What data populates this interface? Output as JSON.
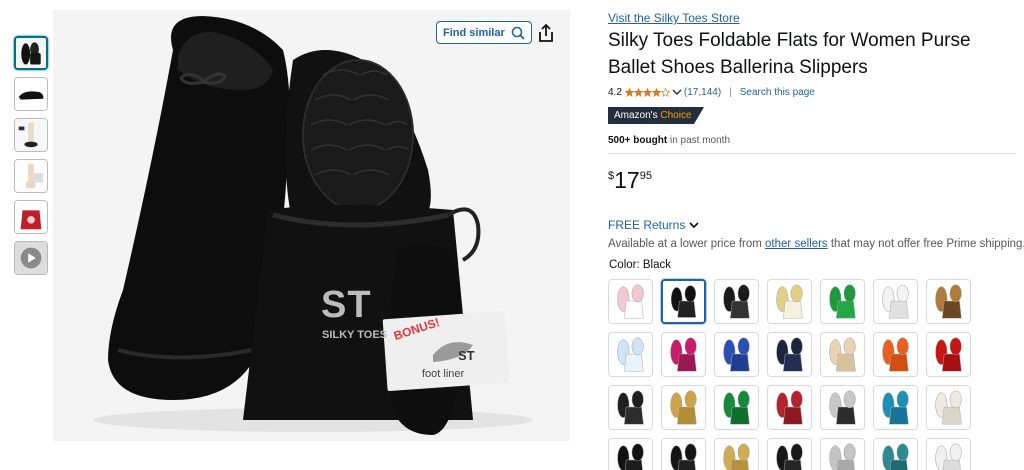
{
  "thumbnails": [
    {
      "name": "thumb-shoes-pouch",
      "active": true
    },
    {
      "name": "thumb-flat-side"
    },
    {
      "name": "thumb-model"
    },
    {
      "name": "thumb-foot-liner"
    },
    {
      "name": "thumb-red-pouch"
    },
    {
      "name": "thumb-video"
    }
  ],
  "main_image": {
    "find_similar_label": "Find similar",
    "logo_text": "ST",
    "logo_caption": "SILKY TOES",
    "bonus_text": "BONUS!",
    "liner_logo": "ST",
    "liner_text": "foot liner"
  },
  "product": {
    "store_link": "Visit the Silky Toes Store",
    "title": "Silky Toes Foldable Flats for Women Purse Ballet Shoes Ballerina Slippers",
    "rating": "4.2",
    "rating_value": 4.2,
    "rating_count": "(17,144)",
    "search_page": "Search this page",
    "badge_prefix": "Amazon's",
    "badge_choice": "Choice",
    "bought_bold": "500+ bought",
    "bought_rest": "in past month",
    "price_symbol": "$",
    "price_whole": "17",
    "price_fraction": "95",
    "returns_label": "FREE Returns",
    "avail_before": "Available at a lower price from ",
    "avail_link": "other sellers",
    "avail_after": " that may not offer free Prime shipping.",
    "color_label": "Color: Black"
  },
  "swatches": [
    {
      "name": "swatch-pink",
      "color": "#f1c9d4",
      "bag": "#ffffff",
      "selected": false
    },
    {
      "name": "swatch-black",
      "color": "#111111",
      "bag": "#222222",
      "selected": true
    },
    {
      "name": "swatch-black-pair",
      "color": "#1a1a1a",
      "bag": "#333333",
      "selected": false
    },
    {
      "name": "swatch-gold-white",
      "color": "#e4cf87",
      "bag": "#f5f0e0",
      "selected": false
    },
    {
      "name": "swatch-green",
      "color": "#1d9a3e",
      "bag": "#22a746",
      "selected": false
    },
    {
      "name": "swatch-white",
      "color": "#f3f3f3",
      "bag": "#e0e0e0",
      "selected": false
    },
    {
      "name": "swatch-leopard",
      "color": "#b07a3b",
      "bag": "#6b4620",
      "selected": false
    },
    {
      "name": "swatch-light-blue",
      "color": "#cfe4f5",
      "bag": "#e9f3fb",
      "selected": false
    },
    {
      "name": "swatch-fuchsia",
      "color": "#c81d6b",
      "bag": "#9c1854",
      "selected": false
    },
    {
      "name": "swatch-royal-blue",
      "color": "#2a4fb5",
      "bag": "#1f3d91",
      "selected": false
    },
    {
      "name": "swatch-navy",
      "color": "#1b2540",
      "bag": "#222e52",
      "selected": false
    },
    {
      "name": "swatch-nude",
      "color": "#e8d4b4",
      "bag": "#d8c19d",
      "selected": false
    },
    {
      "name": "swatch-orange",
      "color": "#e9611e",
      "bag": "#d24f10",
      "selected": false
    },
    {
      "name": "swatch-red",
      "color": "#c91414",
      "bag": "#a51010",
      "selected": false
    },
    {
      "name": "swatch-black-sequin",
      "color": "#1f1f1f",
      "bag": "#2c2c2c",
      "selected": false
    },
    {
      "name": "swatch-gold",
      "color": "#cda44a",
      "bag": "#b48d35",
      "selected": false
    },
    {
      "name": "swatch-emerald",
      "color": "#158a3a",
      "bag": "#0f6e2d",
      "selected": false
    },
    {
      "name": "swatch-metallic-red",
      "color": "#b5232a",
      "bag": "#8e1a20",
      "selected": false
    },
    {
      "name": "swatch-silver-black",
      "color": "#c8c8c8",
      "bag": "#2b2b2b",
      "selected": false
    },
    {
      "name": "swatch-turquoise",
      "color": "#1f8fb8",
      "bag": "#16739a",
      "selected": false
    },
    {
      "name": "swatch-cream",
      "color": "#eeeae0",
      "bag": "#dcd6c8",
      "selected": false
    },
    {
      "name": "swatch-black-2",
      "color": "#121212",
      "bag": "#1d1d1d",
      "selected": false
    },
    {
      "name": "swatch-black-3",
      "color": "#151515",
      "bag": "#202020",
      "selected": false
    },
    {
      "name": "swatch-gold-2",
      "color": "#d2ab55",
      "bag": "#b7913d",
      "selected": false
    },
    {
      "name": "swatch-black-4",
      "color": "#181818",
      "bag": "#262626",
      "selected": false
    },
    {
      "name": "swatch-silver",
      "color": "#c4c4c4",
      "bag": "#a9a9a9",
      "selected": false
    },
    {
      "name": "swatch-teal",
      "color": "#2c8a92",
      "bag": "#1f6a70",
      "selected": false
    },
    {
      "name": "swatch-white-2",
      "color": "#f0f0f0",
      "bag": "#dcdcdc",
      "selected": false
    }
  ]
}
